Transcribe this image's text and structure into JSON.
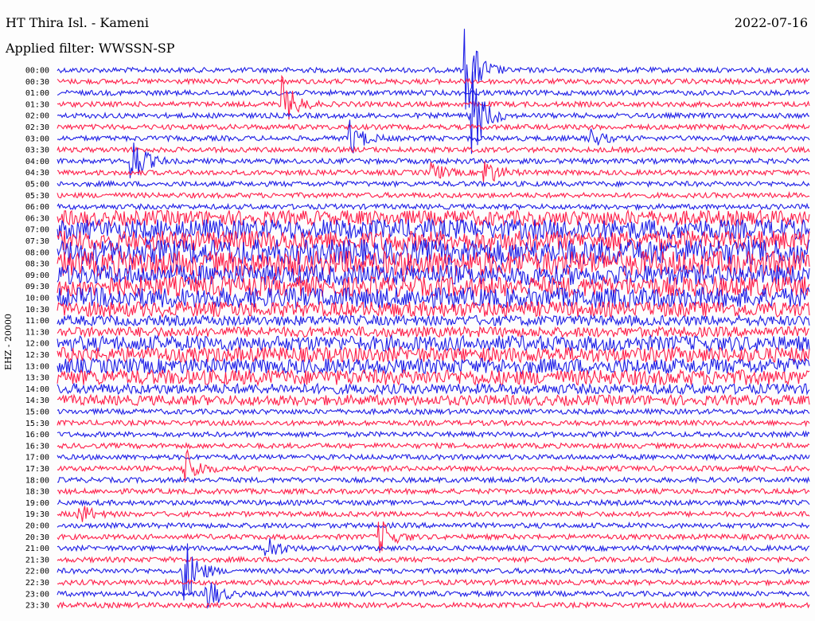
{
  "header": {
    "station": "HT Thira Isl. - Kameni",
    "date": "2022-07-16",
    "filter": "Applied filter: WWSSN-SP"
  },
  "colors": {
    "trace_a": "#1e1ee6",
    "trace_b": "#ff1f4a",
    "background": "#fdfdfd"
  },
  "chart_data": {
    "type": "line",
    "title": "HT Thira Isl. - Kameni",
    "subtitle": "Applied filter: WWSSN-SP",
    "ylabel": "EHZ - 20000",
    "xlabel": "",
    "series": [
      {
        "name": "",
        "color": "#1e1ee6"
      },
      {
        "name": "",
        "color": "#ff1f4a"
      }
    ],
    "row_labels": [
      "00:00",
      "00:30",
      "01:00",
      "01:30",
      "02:00",
      "02:30",
      "03:00",
      "03:30",
      "04:00",
      "04:30",
      "05:00",
      "05:30",
      "06:00",
      "06:30",
      "07:00",
      "07:30",
      "08:00",
      "08:30",
      "09:00",
      "09:30",
      "10:00",
      "10:30",
      "11:00",
      "11:30",
      "12:00",
      "12:30",
      "13:00",
      "13:30",
      "14:00",
      "14:30",
      "15:00",
      "15:30",
      "16:00",
      "16:30",
      "17:00",
      "17:30",
      "18:00",
      "18:30",
      "19:00",
      "19:30",
      "20:00",
      "20:30",
      "21:00",
      "21:30",
      "22:00",
      "22:30",
      "23:00",
      "23:30"
    ],
    "row_noise": [
      1,
      1,
      1,
      1,
      1,
      1,
      1,
      1,
      1,
      1,
      1,
      1,
      1,
      3,
      4,
      4,
      5,
      5,
      4,
      4,
      4,
      3,
      2,
      2,
      3,
      3,
      3,
      3,
      2,
      2,
      1,
      1,
      1,
      1,
      1,
      1,
      1,
      1,
      1,
      1,
      1,
      1,
      1,
      1,
      1,
      1,
      1,
      1
    ],
    "events": [
      {
        "row": 0,
        "at": 0.545,
        "amp": 2.5
      },
      {
        "row": 3,
        "at": 0.3,
        "amp": 1.5
      },
      {
        "row": 4,
        "at": 0.55,
        "amp": 3
      },
      {
        "row": 6,
        "at": 0.39,
        "amp": 1
      },
      {
        "row": 6,
        "at": 0.71,
        "amp": 0.5
      },
      {
        "row": 8,
        "at": 0.1,
        "amp": 1.5
      },
      {
        "row": 9,
        "at": 0.5,
        "amp": 0.5
      },
      {
        "row": 9,
        "at": 0.57,
        "amp": 0.8
      },
      {
        "row": 35,
        "at": 0.17,
        "amp": 1.2
      },
      {
        "row": 39,
        "at": 0.03,
        "amp": 0.6
      },
      {
        "row": 41,
        "at": 0.43,
        "amp": 1
      },
      {
        "row": 42,
        "at": 0.28,
        "amp": 0.7
      },
      {
        "row": 44,
        "at": 0.17,
        "amp": 2
      },
      {
        "row": 46,
        "at": 0.2,
        "amp": 1
      }
    ]
  }
}
